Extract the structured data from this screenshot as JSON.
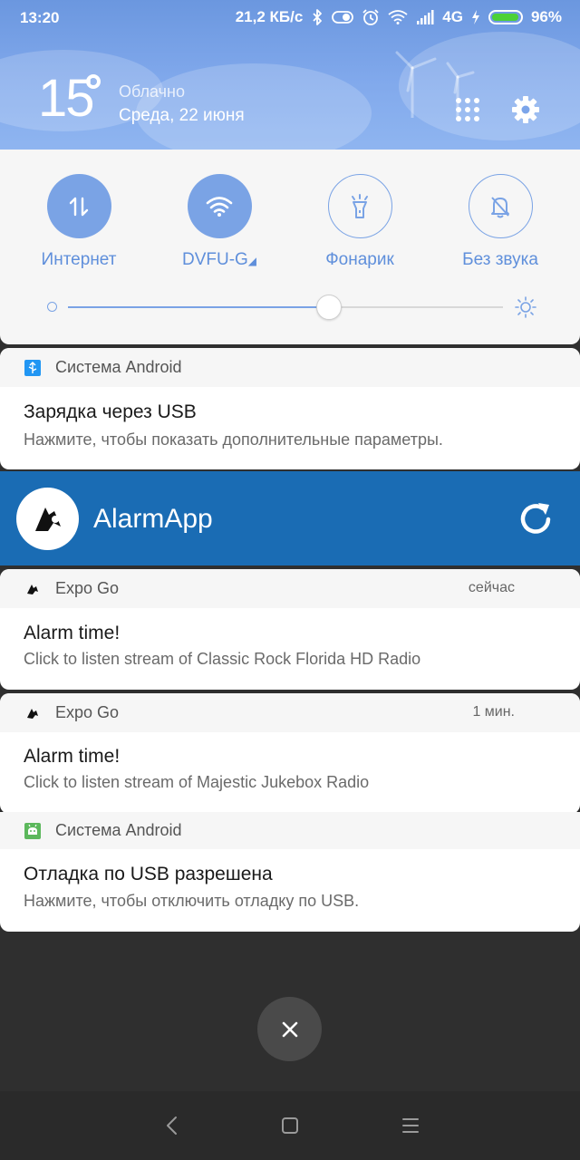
{
  "status_bar": {
    "time": "13:20",
    "network_speed": "21,2 КБ/с",
    "network_type": "4G",
    "battery": "96%",
    "battery_level": 0.96,
    "icons": [
      "bluetooth-icon",
      "toggle-icon",
      "alarm-clock-icon",
      "wifi-icon",
      "signal-icon",
      "charging-icon",
      "battery-icon"
    ]
  },
  "weather": {
    "temperature": "15",
    "condition": "Облачно",
    "date": "Среда, 22 июня"
  },
  "header_buttons": {
    "apps_icon": "grid-icon",
    "settings_icon": "gear-icon"
  },
  "quick_toggles": [
    {
      "label": "Интернет",
      "icon": "data-transfer-icon",
      "active": true
    },
    {
      "label": "DVFU-G",
      "icon": "wifi-icon",
      "active": true
    },
    {
      "label": "Фонарик",
      "icon": "flashlight-icon",
      "active": false
    },
    {
      "label": "Без звука",
      "icon": "bell-off-icon",
      "active": false
    }
  ],
  "brightness": {
    "level": 0.6
  },
  "notifications": [
    {
      "app": "Система Android",
      "icon": "usb-icon",
      "time": "",
      "title": "Зарядка через USB",
      "text": "Нажмите, чтобы показать дополнительные параметры."
    },
    {
      "app": "Expo Go",
      "icon": "expo-icon",
      "time": "сейчас",
      "title": "Alarm time!",
      "text": "Click to listen stream of Classic Rock Florida HD Radio"
    },
    {
      "app": "Expo Go",
      "icon": "expo-icon",
      "time": "1 мин.",
      "title": "Alarm time!",
      "text": "Click to listen stream of Majestic Jukebox Radio"
    },
    {
      "app": "Система Android",
      "icon": "android-debug-icon",
      "time": "",
      "title": "Отладка по USB разрешена",
      "text": "Нажмите, чтобы отключить отладку по USB."
    }
  ],
  "alarm_app": {
    "name": "AlarmApp",
    "bar_color": "#1a6cb4",
    "refresh_icon": "refresh-icon"
  },
  "accent_color": "#7aa3e5",
  "nav": [
    "back-icon",
    "home-icon",
    "menu-icon"
  ]
}
